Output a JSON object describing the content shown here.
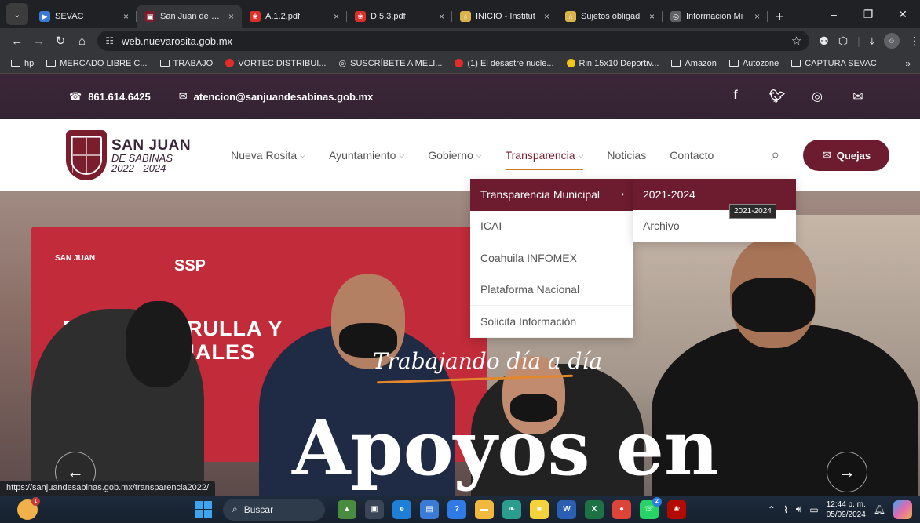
{
  "browser": {
    "tabs": [
      {
        "label": "SEVAC",
        "favicon_color": "#3a7bd5",
        "glyph": "▶"
      },
      {
        "label": "San Juan de Sab",
        "favicon_color": "#7a1d2d",
        "glyph": "▣",
        "active": true
      },
      {
        "label": "A.1.2.pdf",
        "favicon_color": "#d9302c",
        "glyph": "❀"
      },
      {
        "label": "D.5.3.pdf",
        "favicon_color": "#d9302c",
        "glyph": "❀"
      },
      {
        "label": "INICIO - Institut",
        "favicon_color": "#d8b44a",
        "glyph": "☆"
      },
      {
        "label": "Sujetos obligad",
        "favicon_color": "#d8b44a",
        "glyph": "☆"
      },
      {
        "label": "Informacion Mi",
        "favicon_color": "#5f6368",
        "glyph": "◎"
      }
    ],
    "tab_close": "×",
    "new_tab": "+",
    "window_controls": {
      "minimize": "–",
      "restore": "❐",
      "close": "✕"
    },
    "url": "web.nuevarosita.gob.mx",
    "nav": {
      "back": "←",
      "forward": "→",
      "reload": "↻",
      "home": "⌂"
    },
    "bookmarks": [
      {
        "label": "hp",
        "type": "folder"
      },
      {
        "label": "MERCADO LIBRE C...",
        "type": "folder"
      },
      {
        "label": "TRABAJO",
        "type": "folder"
      },
      {
        "label": "VORTEC DISTRIBUI...",
        "type": "youtube",
        "color": "#e52d27"
      },
      {
        "label": "SUSCRÍBETE A MELI...",
        "type": "globe",
        "color": "#e8eaed"
      },
      {
        "label": "(1) El desastre nucle...",
        "type": "youtube",
        "color": "#e52d27"
      },
      {
        "label": "Rin 15x10 Deportiv...",
        "type": "site",
        "color": "#f5c518"
      },
      {
        "label": "Amazon",
        "type": "folder"
      },
      {
        "label": "Autozone",
        "type": "folder"
      },
      {
        "label": "CAPTURA SEVAC",
        "type": "folder"
      }
    ],
    "bookmarks_more": "»",
    "status_url": "https://sanjuandesabinas.gob.mx/transparencia2022/"
  },
  "site": {
    "phone": "861.614.6425",
    "email": "atencion@sanjuandesabinas.gob.mx",
    "logo": {
      "line1": "SAN JUAN",
      "line2": "DE SABINAS",
      "line3": "2022 - 2024"
    },
    "menu": [
      {
        "label": "Nueva Rosita",
        "has_sub": true
      },
      {
        "label": "Ayuntamiento",
        "has_sub": true
      },
      {
        "label": "Gobierno",
        "has_sub": true
      },
      {
        "label": "Transparencia",
        "has_sub": true,
        "active": true
      },
      {
        "label": "Noticias",
        "has_sub": false
      },
      {
        "label": "Contacto",
        "has_sub": false
      }
    ],
    "quejas_label": "Quejas",
    "dropdown": [
      {
        "label": "Transparencia Municipal",
        "highlight": true,
        "has_sub": true
      },
      {
        "label": "ICAI"
      },
      {
        "label": "Coahuila INFOMEX"
      },
      {
        "label": "Plataforma Nacional"
      },
      {
        "label": "Solicita Información"
      }
    ],
    "submenu": [
      {
        "label": "2021-2024",
        "highlight": true
      },
      {
        "label": "Archivo"
      }
    ],
    "tooltip": "2021-2024",
    "hero": {
      "banner_line1": "ENTRE   PATRULLA Y",
      "banner_line2": "CÁM   POLICIALES",
      "banner_logo": "SAN JUAN",
      "banner_ssp": "SSP",
      "script": "Trabajando día a día",
      "big": "Apoyos en"
    },
    "accent": "#6d1b2f"
  },
  "taskbar": {
    "search_label": "Buscar",
    "time": "12:44 p. m.",
    "date": "05/09/2024",
    "apps": [
      {
        "name": "landscape",
        "color": "#4a8c3f",
        "glyph": "▲"
      },
      {
        "name": "taskview",
        "color": "#3a4656",
        "glyph": "▣"
      },
      {
        "name": "edge",
        "color": "#1d7fd6",
        "glyph": "e"
      },
      {
        "name": "store",
        "color": "#3a7bd5",
        "glyph": "▤"
      },
      {
        "name": "helper",
        "color": "#2f7ae5",
        "glyph": "?"
      },
      {
        "name": "explorer",
        "color": "#f0b83c",
        "glyph": "▬"
      },
      {
        "name": "feather",
        "color": "#2a9d8f",
        "glyph": "❧"
      },
      {
        "name": "sticky",
        "color": "#f5d33d",
        "glyph": "■"
      },
      {
        "name": "word",
        "color": "#2b5fb4",
        "glyph": "W"
      },
      {
        "name": "excel",
        "color": "#1e7145",
        "glyph": "X"
      },
      {
        "name": "chrome",
        "color": "#db4437",
        "glyph": "●"
      },
      {
        "name": "whatsapp",
        "color": "#25d366",
        "glyph": "☏",
        "badge": "2"
      },
      {
        "name": "acrobat",
        "color": "#b30b00",
        "glyph": "❀"
      }
    ]
  }
}
